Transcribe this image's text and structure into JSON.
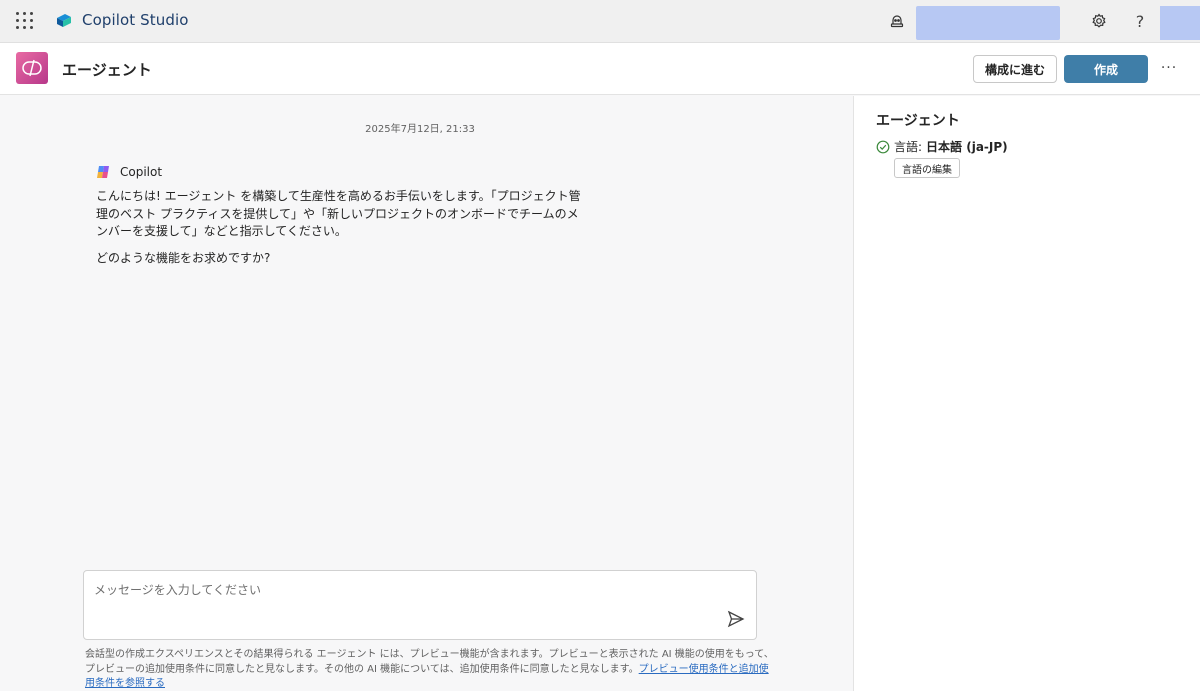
{
  "app": {
    "name": "Copilot Studio"
  },
  "header": {
    "title": "エージェント",
    "config_button": "構成に進む",
    "create_button": "作成",
    "more_label": "···"
  },
  "chat": {
    "timestamp": "2025年7月12日, 21:33",
    "bot_name": "Copilot",
    "messages": [
      "こんにちは! エージェント を構築して生産性を高めるお手伝いをします。「プロジェクト管理のベスト プラクティスを提供して」や「新しいプロジェクトのオンボードでチームのメンバーを支援して」などと指示してください。",
      "どのような機能をお求めですか?"
    ],
    "input": {
      "value": "",
      "placeholder": "メッセージを入力してください"
    },
    "disclaimer": "会話型の作成エクスペリエンスとその結果得られる エージェント には、プレビュー機能が含まれます。プレビューと表示された AI 機能の使用をもって、プレビューの追加使用条件に同意したと見なします。その他の AI 機能については、追加使用条件に同意したと見なします。",
    "disclaimer_link": "プレビュー使用条件と追加使用条件を参照する"
  },
  "panel": {
    "title": "エージェント",
    "language_label": "言語:",
    "language_value": "日本語 (ja-JP)",
    "edit_button": "言語の編集"
  },
  "icons": {
    "waffle": "app-launcher-icon",
    "brand": "copilot-studio-logo-icon",
    "environment": "environment-icon",
    "settings": "gear-icon",
    "help": "help-icon",
    "send": "send-icon",
    "status": "check-circle-icon"
  },
  "colors": {
    "primary": "#3f7ea8",
    "brand_text": "#1f3f6b",
    "agent_icon": "#d0508f",
    "link": "#2a6bc0",
    "placeholder_block": "#b7c8f3"
  }
}
